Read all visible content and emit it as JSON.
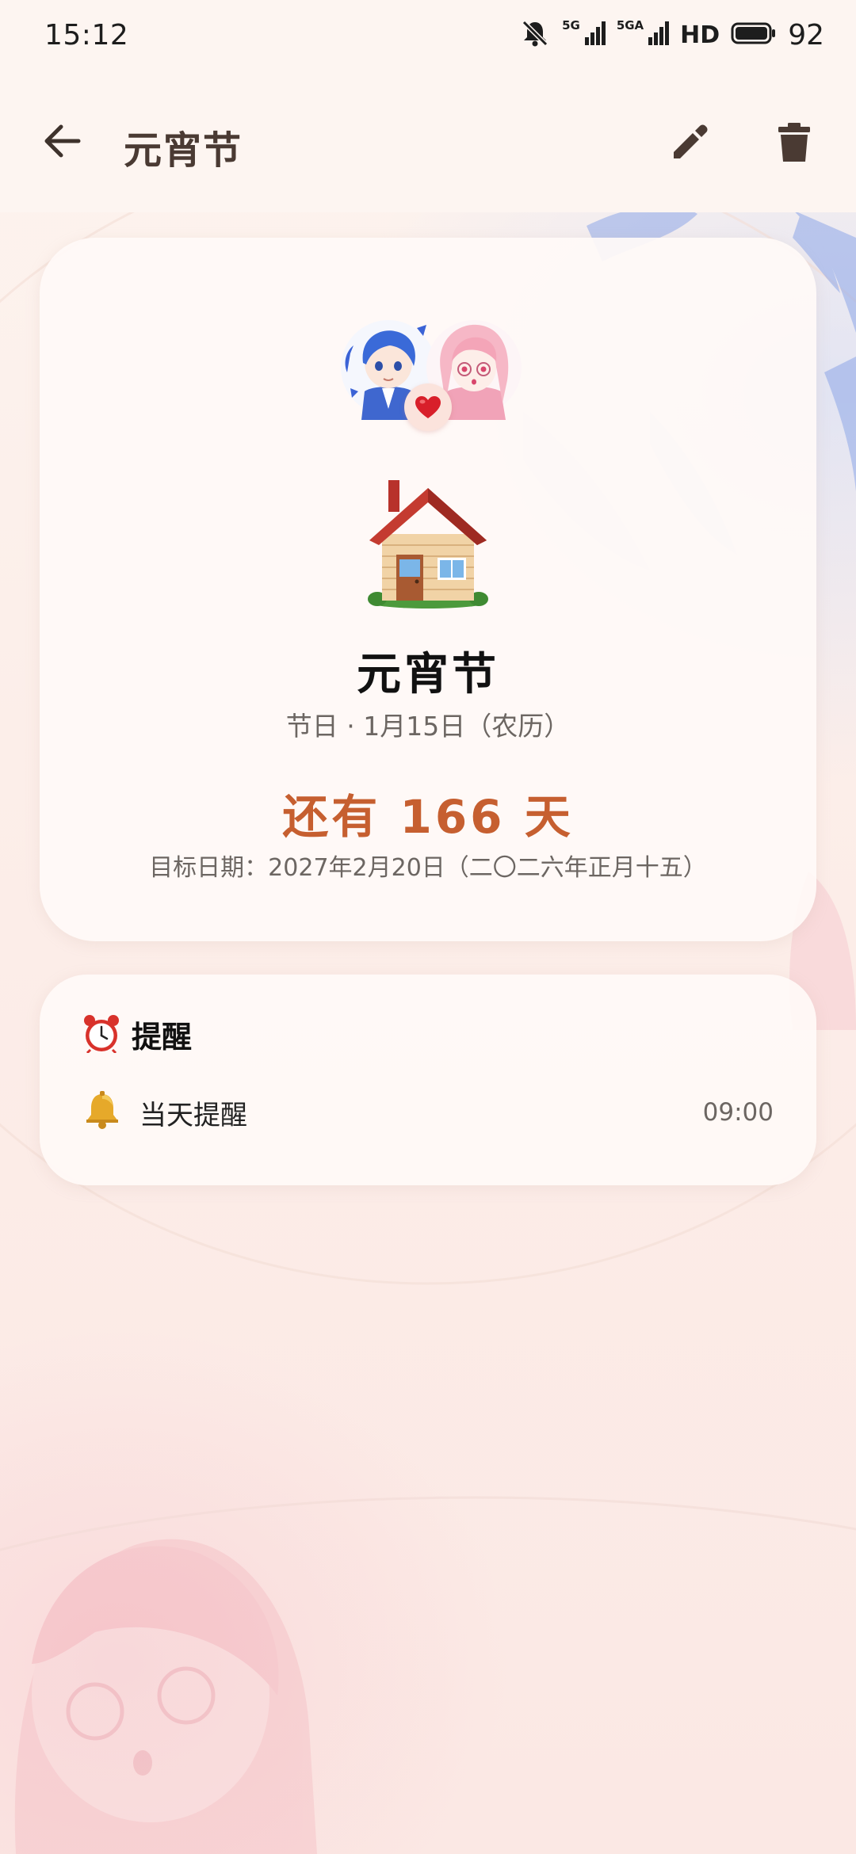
{
  "status_bar": {
    "time": "15:12",
    "net_label_1": "5G",
    "net_label_2": "5GA",
    "hd_label": "HD",
    "battery": "92"
  },
  "app_bar": {
    "title": "元宵节",
    "back_icon": "arrow-left-icon",
    "edit_icon": "pencil-icon",
    "delete_icon": "trash-icon"
  },
  "event": {
    "name": "元宵节",
    "subtitle": "节日 · 1月15日（农历）",
    "countdown": "还有 166 天",
    "target_date": "目标日期：2027年2月20日（二〇二六年正月十五）",
    "icon": "house-icon"
  },
  "reminders": {
    "title": "提醒",
    "title_icon": "alarm-clock-icon",
    "items": [
      {
        "icon": "bell-icon",
        "label": "当天提醒",
        "time": "09:00"
      }
    ]
  },
  "colors": {
    "accent": "#c65f30",
    "title": "#4a3a33",
    "background": "#fbeee9"
  }
}
